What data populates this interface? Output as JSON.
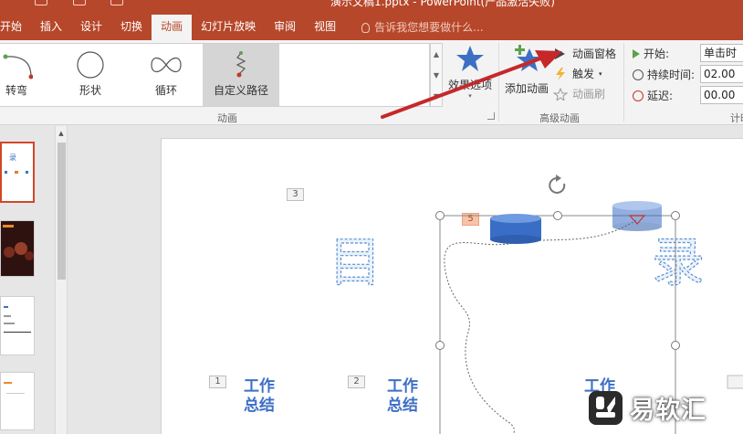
{
  "window": {
    "title": "演示文稿1.pptx - PowerPoint(产品激活失败)"
  },
  "tabs": [
    {
      "label": "开始"
    },
    {
      "label": "插入"
    },
    {
      "label": "设计"
    },
    {
      "label": "切换"
    },
    {
      "label": "动画",
      "active": true
    },
    {
      "label": "幻灯片放映"
    },
    {
      "label": "审阅"
    },
    {
      "label": "视图"
    }
  ],
  "tell_me": {
    "placeholder": "告诉我您想要做什么..."
  },
  "ribbon": {
    "animation_gallery": [
      {
        "label": "转弯",
        "icon": "turn-path-icon"
      },
      {
        "label": "形状",
        "icon": "shape-path-icon"
      },
      {
        "label": "循环",
        "icon": "loop-path-icon"
      },
      {
        "label": "自定义路径",
        "icon": "custom-path-icon",
        "selected": true
      }
    ],
    "effect_options": {
      "label": "效果选项"
    },
    "add_animation": {
      "label": "添加动画"
    },
    "animation_pane": {
      "label": "动画窗格"
    },
    "trigger": {
      "label": "触发"
    },
    "animation_painter": {
      "label": "动画刷"
    },
    "group_labels": {
      "animation": "动画",
      "advanced": "高级动画",
      "timing": "计时"
    },
    "timing": {
      "start_label": "开始:",
      "start_value": "单击时",
      "duration_label": "持续时间:",
      "duration_value": "02.00",
      "delay_label": "延迟:",
      "delay_value": "00.00"
    }
  },
  "slide": {
    "tags": [
      "3",
      "5",
      "1",
      "2"
    ],
    "title_left": "目",
    "title_right": "录",
    "items": [
      "工作\n总结",
      "工作\n总结",
      "工作"
    ]
  },
  "watermark": {
    "text": "易软汇"
  },
  "colors": {
    "accent": "#b7472a",
    "star": "#3d6fc4",
    "arrow": "#c6282a",
    "outline_text": "#5b8fd1"
  }
}
